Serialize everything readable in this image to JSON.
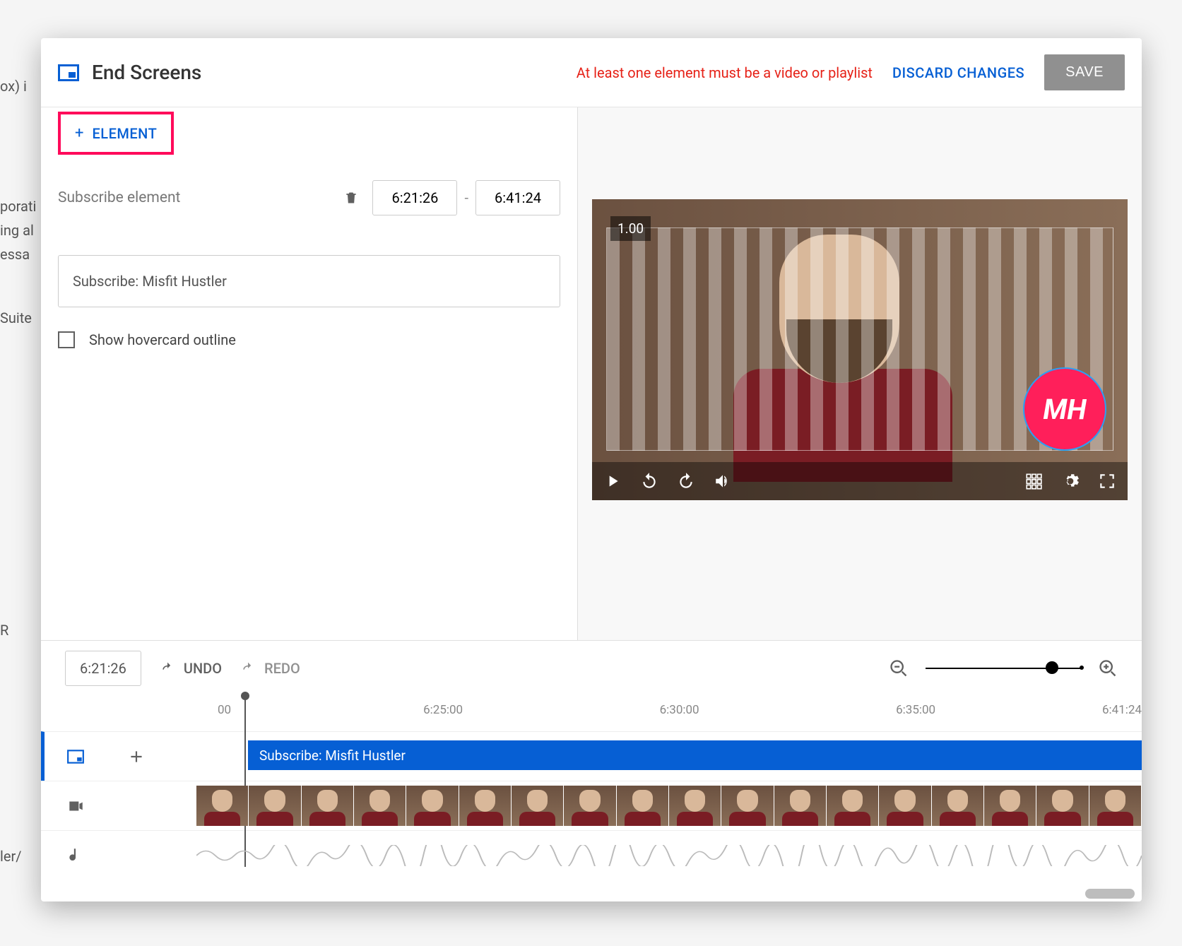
{
  "header": {
    "title": "End Screens",
    "warning": "At least one element must be a video or playlist",
    "discard": "DISCARD CHANGES",
    "save": "SAVE"
  },
  "leftPane": {
    "elementBtn": "ELEMENT",
    "subtitle": "Subscribe element",
    "startTime": "6:21:26",
    "endTime": "6:41:24",
    "subscribeBox": "Subscribe: Misfit Hustler",
    "checkbox": "Show hovercard outline"
  },
  "player": {
    "zoomBadge": "1.00",
    "subscribeLogoText": "MH"
  },
  "timeline": {
    "current": "6:21:26",
    "undo": "UNDO",
    "redo": "REDO",
    "ruler": [
      "00",
      "6:25:00",
      "6:30:00",
      "6:35:00",
      "6:41:24"
    ],
    "segLabel": "Subscribe: Misfit Hustler"
  },
  "bg": {
    "t1": "ox) i",
    "t2": "porati",
    "t3": "ing al",
    "t4": "essa",
    "t5": "Suite",
    "t6": "R",
    "t7": "ler/"
  }
}
